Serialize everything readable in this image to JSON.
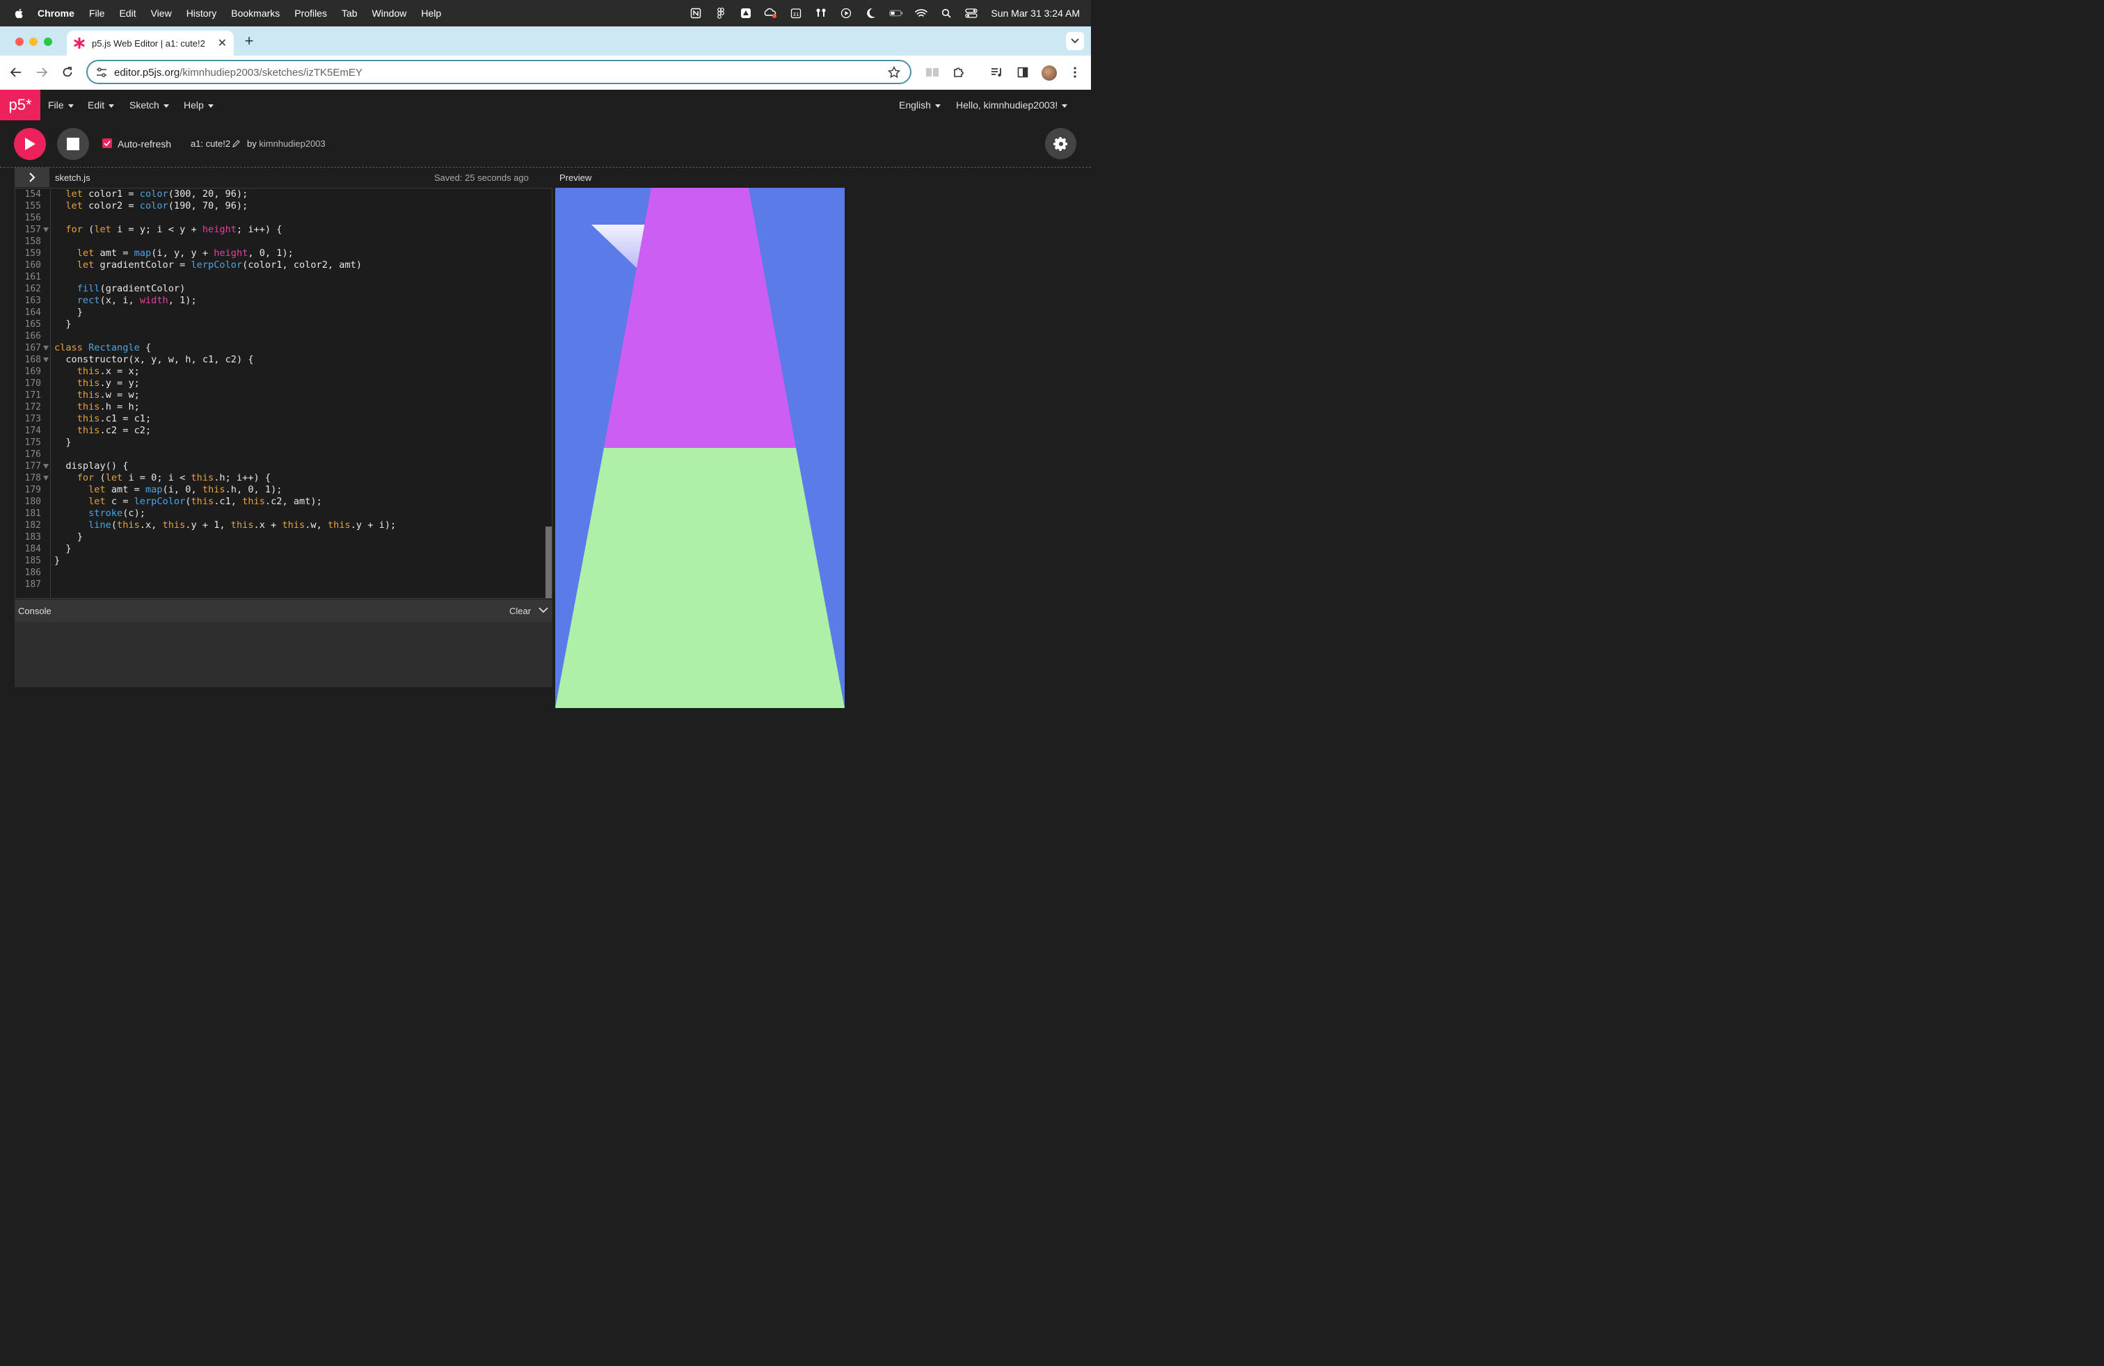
{
  "macos_menubar": {
    "app_name": "Chrome",
    "menus": [
      "File",
      "Edit",
      "View",
      "History",
      "Bookmarks",
      "Profiles",
      "Tab",
      "Window",
      "Help"
    ],
    "datetime": "Sun Mar 31  3:24 AM"
  },
  "browser": {
    "tab_title": "p5.js Web Editor | a1: cute!2",
    "url_host": "editor.p5js.org",
    "url_path": "/kimnhudiep2003/sketches/izTK5EmEY"
  },
  "p5_nav": {
    "logo": "p5*",
    "menus": [
      "File",
      "Edit",
      "Sketch",
      "Help"
    ],
    "language": "English",
    "greeting": "Hello, kimnhudiep2003!"
  },
  "sketch_toolbar": {
    "auto_refresh_label": "Auto-refresh",
    "auto_refresh_checked": true,
    "sketch_name": "a1: cute!2",
    "by_label": "by",
    "author": "kimnhudiep2003"
  },
  "editor": {
    "filename": "sketch.js",
    "saved_status": "Saved: 25 seconds ago",
    "preview_label": "Preview",
    "line_numbers": [
      "154",
      "155",
      "156",
      "157",
      "158",
      "159",
      "160",
      "161",
      "162",
      "163",
      "164",
      "165",
      "166",
      "167",
      "168",
      "169",
      "170",
      "171",
      "172",
      "173",
      "174",
      "175",
      "176",
      "177",
      "178",
      "179",
      "180",
      "181",
      "182",
      "183",
      "184",
      "185",
      "186",
      "187"
    ],
    "folded_lines": [
      "157",
      "167",
      "168",
      "177",
      "178"
    ],
    "code_lines": [
      "  let color1 = color(300, 20, 96);",
      "  let color2 = color(190, 70, 96);",
      "",
      "  for (let i = y; i < y + height; i++) {",
      "",
      "    let amt = map(i, y, y + height, 0, 1);",
      "    let gradientColor = lerpColor(color1, color2, amt)",
      "",
      "    fill(gradientColor)",
      "    rect(x, i, width, 1);",
      "    }",
      "  }",
      "",
      "class Rectangle {",
      "  constructor(x, y, w, h, c1, c2) {",
      "    this.x = x;",
      "    this.y = y;",
      "    this.w = w;",
      "    this.h = h;",
      "    this.c1 = c1;",
      "    this.c2 = c2;",
      "  }",
      "",
      "  display() {",
      "    for (let i = 0; i < this.h; i++) {",
      "      let amt = map(i, 0, this.h, 0, 1);",
      "      let c = lerpColor(this.c1, this.c2, amt);",
      "      stroke(c);",
      "      line(this.x, this.y + 1, this.x + this.w, this.y + i);",
      "    }",
      "  }",
      "}",
      "",
      ""
    ]
  },
  "console": {
    "label": "Console",
    "clear_label": "Clear"
  },
  "colors": {
    "p5_pink": "#ed225d",
    "preview_bg": "#5a7be8",
    "trapezoid_top": "#cc5ef3",
    "trapezoid_bottom": "#aef0a8"
  }
}
